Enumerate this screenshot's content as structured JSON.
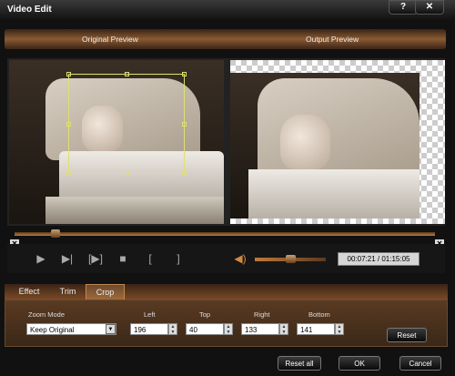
{
  "window": {
    "title": "Video Edit",
    "help_label": "?",
    "close_label": "✕"
  },
  "header": {
    "original_label": "Original Preview",
    "output_label": "Output Preview"
  },
  "playback": {
    "timecode": "00:07:21 / 01:15:05"
  },
  "tabs": [
    {
      "label": "Effect"
    },
    {
      "label": "Trim"
    },
    {
      "label": "Crop",
      "selected": true
    }
  ],
  "crop": {
    "zoom_mode_label": "Zoom Mode",
    "zoom_mode_value": "Keep Original",
    "left_label": "Left",
    "left_value": "196",
    "top_label": "Top",
    "top_value": "40",
    "right_label": "Right",
    "right_value": "133",
    "bottom_label": "Bottom",
    "bottom_value": "141",
    "reset_label": "Reset"
  },
  "footer": {
    "reset_all_label": "Reset all",
    "ok_label": "OK",
    "cancel_label": "Cancel"
  },
  "colors": {
    "accent": "#a06a3a",
    "crop_frame": "#e0e070"
  }
}
